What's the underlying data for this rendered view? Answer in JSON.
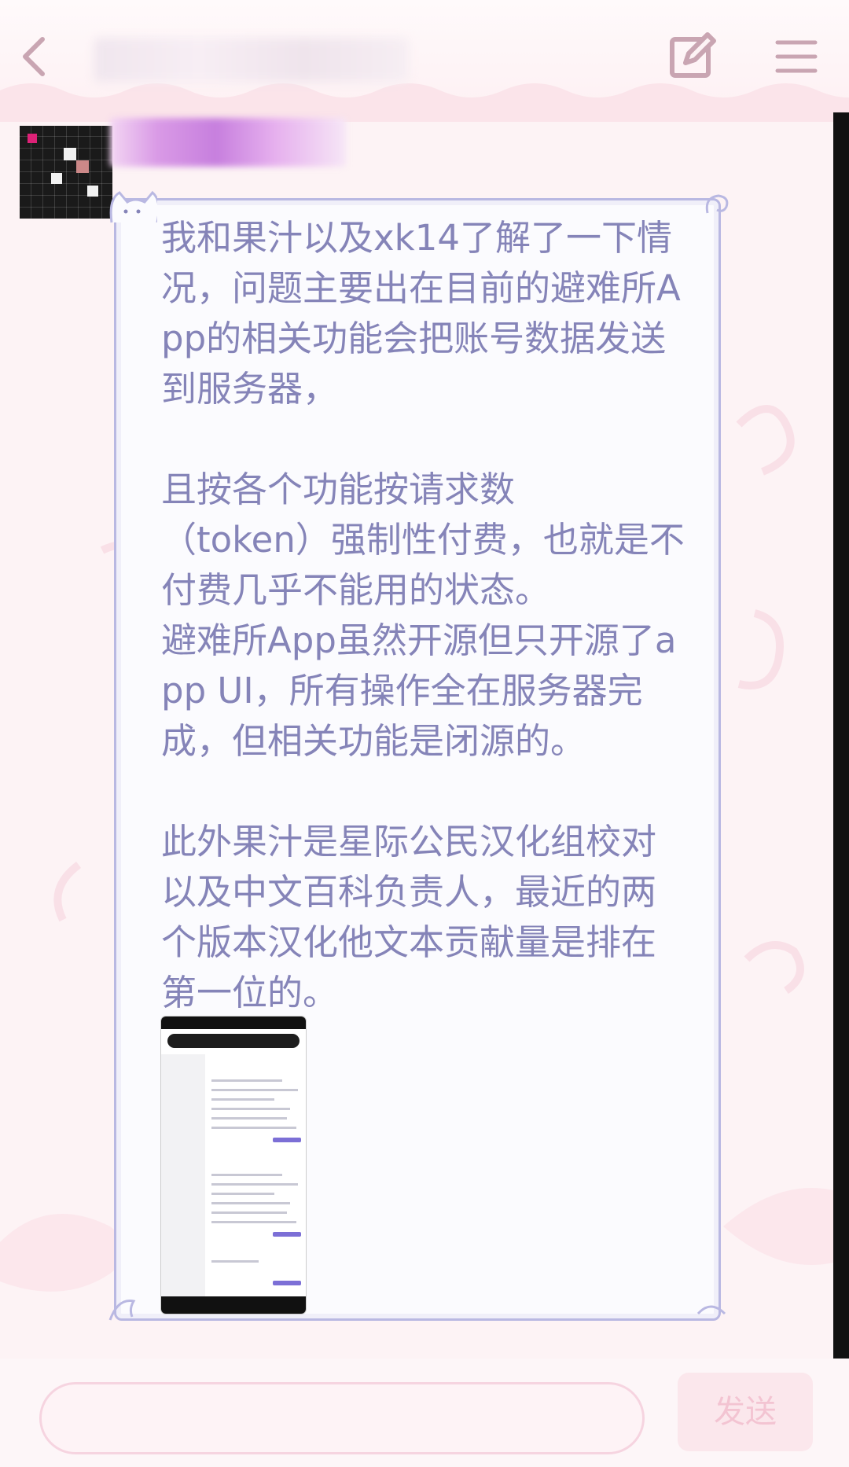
{
  "header": {
    "back_icon": "chevron-left-icon",
    "edit_icon": "edit-square-icon",
    "menu_icon": "hamburger-menu-icon"
  },
  "message": {
    "text": "我和果汁以及xk14了解了一下情况，问题主要出在目前的避难所App的相关功能会把账号数据发送到服务器，\n\n且按各个功能按请求数\n（token）强制性付费，也就是不付费几乎不能用的状态。\n避难所App虽然开源但只开源了app UI，所有操作全在服务器完成，但相关功能是闭源的。\n\n此外果汁是星际公民汉化组校对以及中文百科负责人，最近的两个版本汉化他文本贡献量是排在第一位的。"
  },
  "composer": {
    "send_label": "发送"
  },
  "colors": {
    "bubble_text": "#8584b8",
    "bubble_border": "#b9b8e2",
    "icon": "#c9a5b2",
    "send_text": "#f3c4d2"
  }
}
